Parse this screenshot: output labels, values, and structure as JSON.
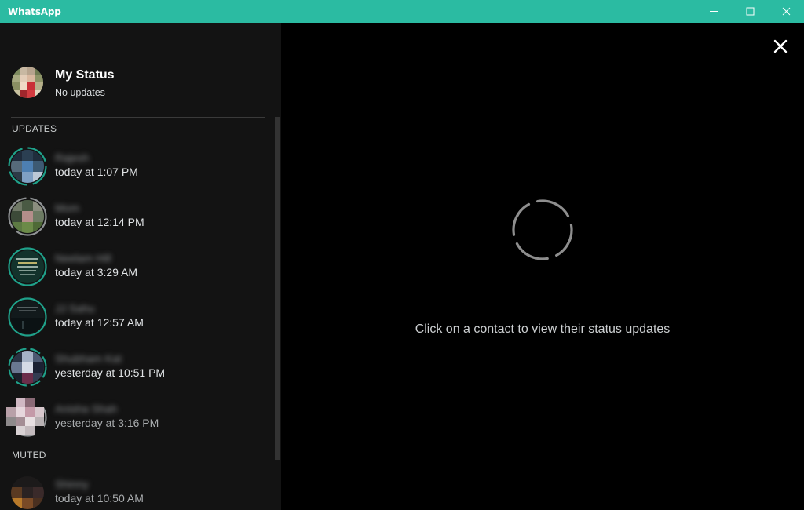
{
  "window": {
    "title": "WhatsApp",
    "controls": [
      "minimize-icon",
      "maximize-icon",
      "close-icon"
    ]
  },
  "colors": {
    "accent": "#2bbba2",
    "ring_unseen": "#1fa18a",
    "ring_seen": "#8f9294",
    "background_sidebar": "#131313",
    "background_main": "#000000"
  },
  "my_status": {
    "name": "My Status",
    "subtitle": "No updates"
  },
  "sections": {
    "updates": "UPDATES",
    "muted": "MUTED"
  },
  "updates": [
    {
      "name": "Rajesh",
      "time": "today at 1:07 PM",
      "ring": "unseen"
    },
    {
      "name": "Mom",
      "time": "today at 12:14 PM",
      "ring": "seen"
    },
    {
      "name": "Neelam Hill",
      "time": "today at 3:29 AM",
      "ring": "unseen"
    },
    {
      "name": "JJ Sahu",
      "time": "today at 12:57 AM",
      "ring": "unseen"
    },
    {
      "name": "Shubham Kat",
      "time": "yesterday at 10:51 PM",
      "ring": "unseen"
    },
    {
      "name": "Anisha Shah",
      "time": "yesterday at 3:16 PM",
      "ring": "seen"
    }
  ],
  "muted": [
    {
      "name": "Shinny",
      "time": "today at 10:50 AM",
      "ring": "none"
    }
  ],
  "main": {
    "empty_hint": "Click on a contact to view their status updates"
  },
  "icons": {
    "close": "close-icon",
    "loading": "loading-spinner-icon"
  }
}
